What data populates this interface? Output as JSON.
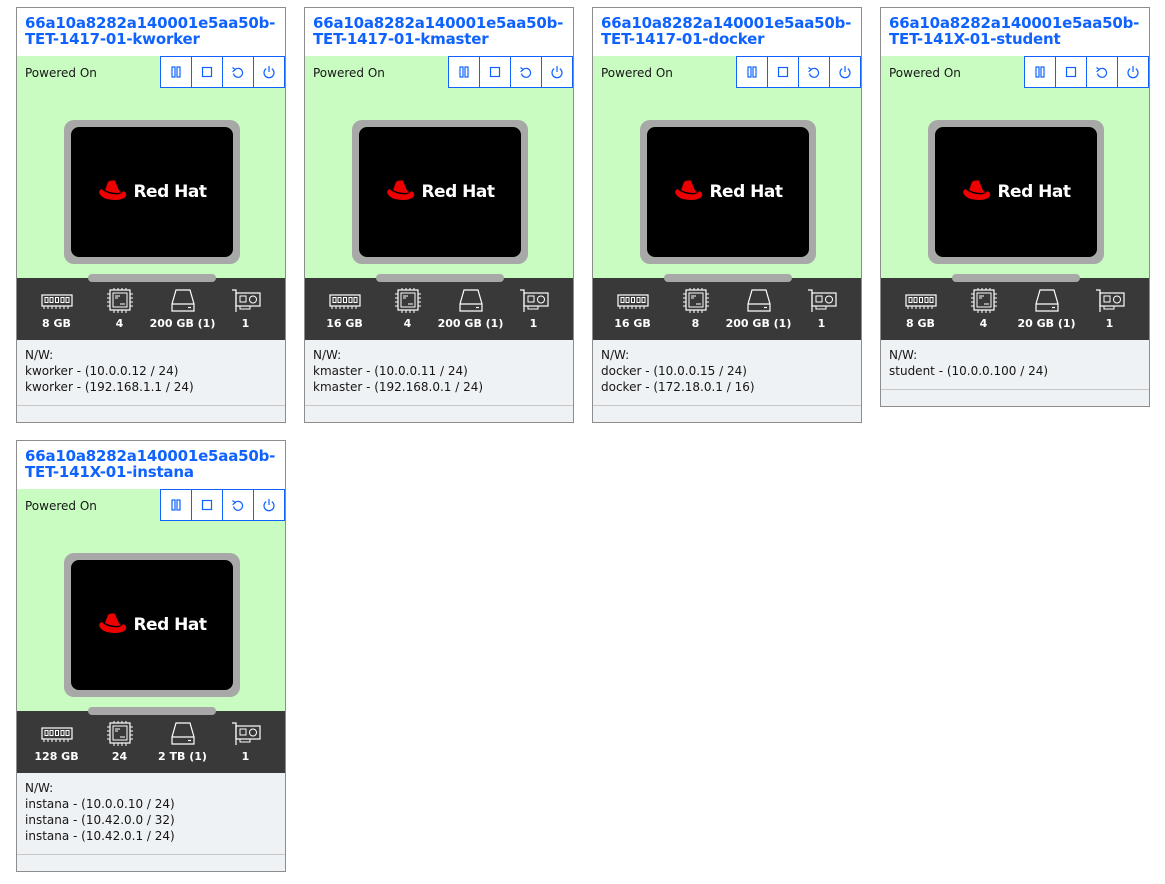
{
  "labels": {
    "status": "Powered On",
    "nw_header": "N/W:",
    "logo_text": "Red Hat"
  },
  "colors": {
    "accent": "#0f62fe",
    "powered_bg": "#c8fcc0",
    "spec_bg": "#393939",
    "logo_red": "#ee0000"
  },
  "vms": [
    {
      "title_line1": "66a10a8282a140001e5aa50b-",
      "title_line2": "TET-1417-01-kworker",
      "status": "Powered On",
      "ram": "8 GB",
      "cpu": "4",
      "disk": "200 GB (1)",
      "nic": "1",
      "networks": [
        "kworker - (10.0.0.12 / 24)",
        "kworker - (192.168.1.1 / 24)"
      ]
    },
    {
      "title_line1": "66a10a8282a140001e5aa50b-",
      "title_line2": "TET-1417-01-kmaster",
      "status": "Powered On",
      "ram": "16 GB",
      "cpu": "4",
      "disk": "200 GB (1)",
      "nic": "1",
      "networks": [
        "kmaster - (10.0.0.11 / 24)",
        "kmaster - (192.168.0.1 / 24)"
      ]
    },
    {
      "title_line1": "66a10a8282a140001e5aa50b-",
      "title_line2": "TET-1417-01-docker",
      "status": "Powered On",
      "ram": "16 GB",
      "cpu": "8",
      "disk": "200 GB (1)",
      "nic": "1",
      "networks": [
        "docker - (10.0.0.15 / 24)",
        "docker - (172.18.0.1 / 16)"
      ]
    },
    {
      "title_line1": "66a10a8282a140001e5aa50b-",
      "title_line2": "TET-141X-01-student",
      "status": "Powered On",
      "ram": "8 GB",
      "cpu": "4",
      "disk": "20 GB (1)",
      "nic": "1",
      "networks": [
        "student - (10.0.0.100 / 24)"
      ]
    },
    {
      "title_line1": "66a10a8282a140001e5aa50b-",
      "title_line2": "TET-141X-01-instana",
      "status": "Powered On",
      "ram": "128 GB",
      "cpu": "24",
      "disk": "2 TB (1)",
      "nic": "1",
      "networks": [
        "instana - (10.0.0.10 / 24)",
        "instana - (10.42.0.0 / 32)",
        "instana - (10.42.0.1 / 24)"
      ]
    }
  ],
  "icons": {
    "controls": [
      "pause-icon",
      "stop-icon",
      "restart-icon",
      "power-icon"
    ],
    "specs": [
      "memory-icon",
      "cpu-icon",
      "disk-icon",
      "nic-icon"
    ]
  }
}
